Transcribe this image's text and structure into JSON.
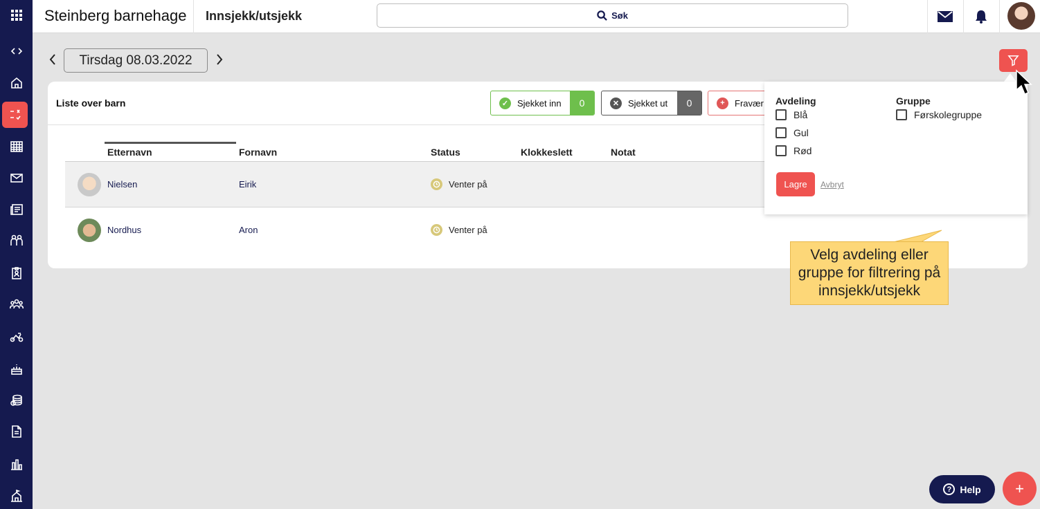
{
  "colors": {
    "navy": "#151a4f",
    "accent": "#ef5350",
    "green": "#6ebf4c",
    "tooltip": "#fdd778"
  },
  "sidebar": {
    "items": [
      {
        "icon": "apps-grid-icon"
      },
      {
        "icon": "expand-code-icon"
      },
      {
        "icon": "home-icon"
      },
      {
        "icon": "checkin-icon"
      },
      {
        "icon": "calendar-icon"
      },
      {
        "icon": "mail-icon"
      },
      {
        "icon": "news-icon"
      },
      {
        "icon": "children-icon"
      },
      {
        "icon": "badge-icon"
      },
      {
        "icon": "group-icon"
      },
      {
        "icon": "activity-icon"
      },
      {
        "icon": "cake-icon"
      },
      {
        "icon": "coins-icon"
      },
      {
        "icon": "document-icon"
      },
      {
        "icon": "chart-icon"
      },
      {
        "icon": "building-icon"
      }
    ]
  },
  "header": {
    "org_name": "Steinberg barnehage",
    "page_title": "Innsjekk/utsjekk",
    "search_label": "Søk"
  },
  "date_nav": {
    "date_label": "Tirsdag 08.03.2022"
  },
  "card": {
    "title": "Liste over barn",
    "stats": {
      "checked_in": {
        "label": "Sjekket inn",
        "count": "0"
      },
      "checked_out": {
        "label": "Sjekket ut",
        "count": "0"
      },
      "absent": {
        "label": "Fravær"
      }
    },
    "columns": [
      "Etternavn",
      "Fornavn",
      "Status",
      "Klokkeslett",
      "Notat"
    ],
    "rows": [
      {
        "last_name": "Nielsen",
        "first_name": "Eirik",
        "status": "Venter på"
      },
      {
        "last_name": "Nordhus",
        "first_name": "Aron",
        "status": "Venter på"
      }
    ]
  },
  "filter": {
    "department_heading": "Avdeling",
    "departments": [
      "Blå",
      "Gul",
      "Rød"
    ],
    "group_heading": "Gruppe",
    "groups": [
      "Førskolegruppe"
    ],
    "save_label": "Lagre",
    "cancel_label": "Avbryt"
  },
  "tooltip": {
    "text": "Velg avdeling eller gruppe for filtrering på innsjekk/utsjekk"
  },
  "help": {
    "label": "Help"
  },
  "fab": {
    "label": "+"
  }
}
